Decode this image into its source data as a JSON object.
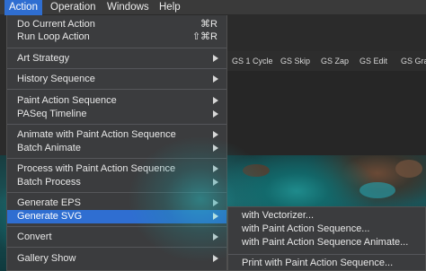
{
  "menubar": {
    "items": [
      "Action",
      "Operation",
      "Windows",
      "Help"
    ],
    "active": "Action"
  },
  "toolbar": {
    "buttons": [
      "GS 1 Cycle",
      "GS Skip",
      "GS Zap",
      "GS Edit",
      "GS Grab"
    ]
  },
  "action_menu": {
    "items": [
      {
        "label": "Do Current Action",
        "shortcut": "⌘R"
      },
      {
        "label": "Run Loop Action",
        "shortcut": "⇧⌘R"
      },
      {
        "label": "Art Strategy"
      },
      {
        "label": "History Sequence"
      },
      {
        "label": "Paint Action Sequence"
      },
      {
        "label": "PASeq Timeline"
      },
      {
        "label": "Animate with Paint Action Sequence"
      },
      {
        "label": "Batch Animate"
      },
      {
        "label": "Process with Paint Action Sequence"
      },
      {
        "label": "Batch Process"
      },
      {
        "label": "Generate EPS"
      },
      {
        "label": "Generate SVG",
        "highlighted": true
      },
      {
        "label": "Convert"
      },
      {
        "label": "Gallery Show"
      }
    ]
  },
  "svg_submenu": {
    "items": [
      "with Vectorizer...",
      "with Paint Action Sequence...",
      "with Paint Action Sequence Animate...",
      "Print with Paint Action Sequence..."
    ]
  },
  "colors": {
    "highlight": "#2f6ed1",
    "menu_bg": "#3b3c3e",
    "teal": "#1e8f93"
  }
}
